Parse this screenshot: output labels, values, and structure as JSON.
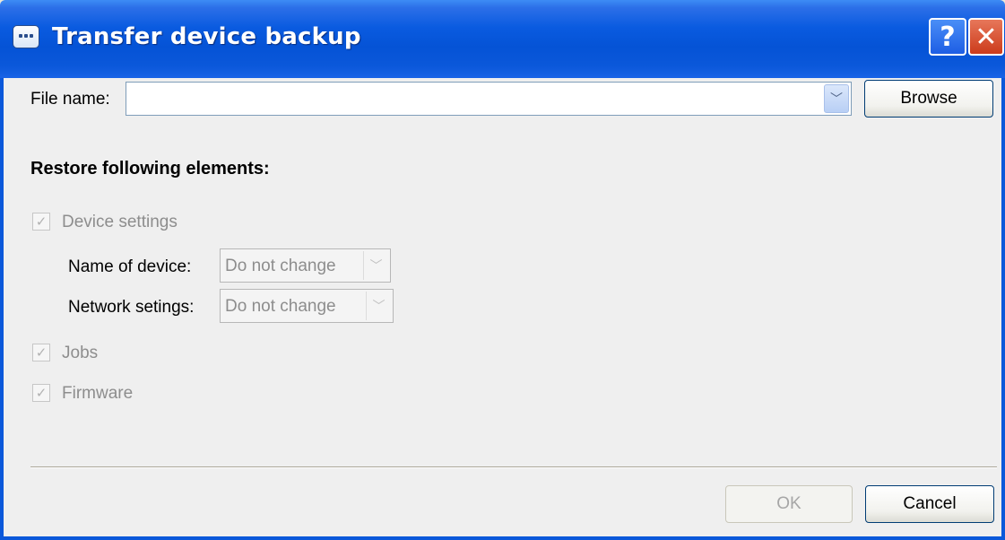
{
  "window": {
    "title": "Transfer device backup",
    "help_label": "?",
    "close_label": "✕"
  },
  "file": {
    "label": "File name:",
    "value": "",
    "browse_label": "Browse"
  },
  "restore": {
    "heading": "Restore following elements:",
    "device_settings": {
      "label": "Device settings",
      "checked": true
    },
    "name_of_device": {
      "label": "Name of device:",
      "value": "Do not change"
    },
    "network_settings": {
      "label": "Network setings:",
      "value": "Do not change"
    },
    "jobs": {
      "label": "Jobs",
      "checked": true
    },
    "firmware": {
      "label": "Firmware",
      "checked": true
    }
  },
  "footer": {
    "ok_label": "OK",
    "cancel_label": "Cancel"
  },
  "icons": {
    "check": "✓",
    "dropdown": "﹀"
  },
  "colors": {
    "titlebar": "#0B58DA",
    "client_bg": "#EFEFEF",
    "disabled_text": "#8D8D8D"
  }
}
